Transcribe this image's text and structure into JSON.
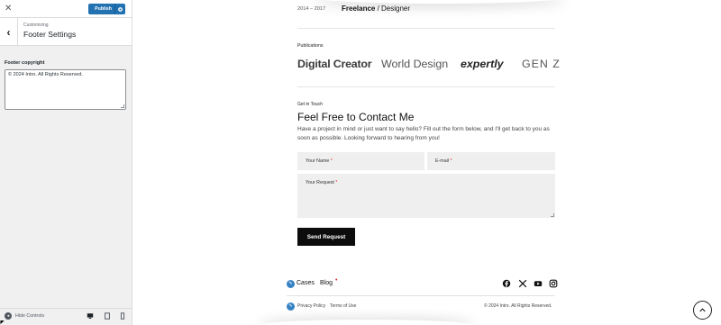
{
  "sidebar": {
    "close_glyph": "✕",
    "publish_label": "Publish",
    "section_sub": "Customizing",
    "section_title": "Footer Settings",
    "back_glyph": "‹",
    "field_label": "Footer copyright",
    "field_value": "© 2024 Intro. All Rights Reserved.",
    "hide_controls_label": "Hide Controls",
    "devices": [
      "desktop",
      "tablet",
      "mobile"
    ],
    "accent_color": "#2271b1"
  },
  "preview": {
    "experience": {
      "years": "2014 – 2017",
      "role_strong": "Freelance",
      "role_rest": " / Designer"
    },
    "publications": {
      "label": "Publications",
      "logos": [
        "Digital Creator",
        "World Design",
        "expertly",
        "GEN Z"
      ]
    },
    "contact": {
      "eyebrow": "Get in Touch",
      "title": "Feel Free to Contact Me",
      "description": "Have a project in mind or just want to say hello? Fill out the form below, and I'll get back to you as soon as possible. Looking forward to hearing from you!",
      "name_placeholder": "Your Name",
      "email_placeholder": "E-mail",
      "request_placeholder": "Your Request",
      "required_mark": "*",
      "send_label": "Send Request"
    },
    "footer": {
      "nav": [
        "Cases",
        "Blog"
      ],
      "nav_dot": "•",
      "social": [
        "facebook-icon",
        "x-icon",
        "youtube-icon",
        "instagram-icon"
      ],
      "privacy": "Privacy Policy",
      "terms": "Terms of Use",
      "copyright": "© 2024 Intro. All Rights Reserved."
    }
  }
}
